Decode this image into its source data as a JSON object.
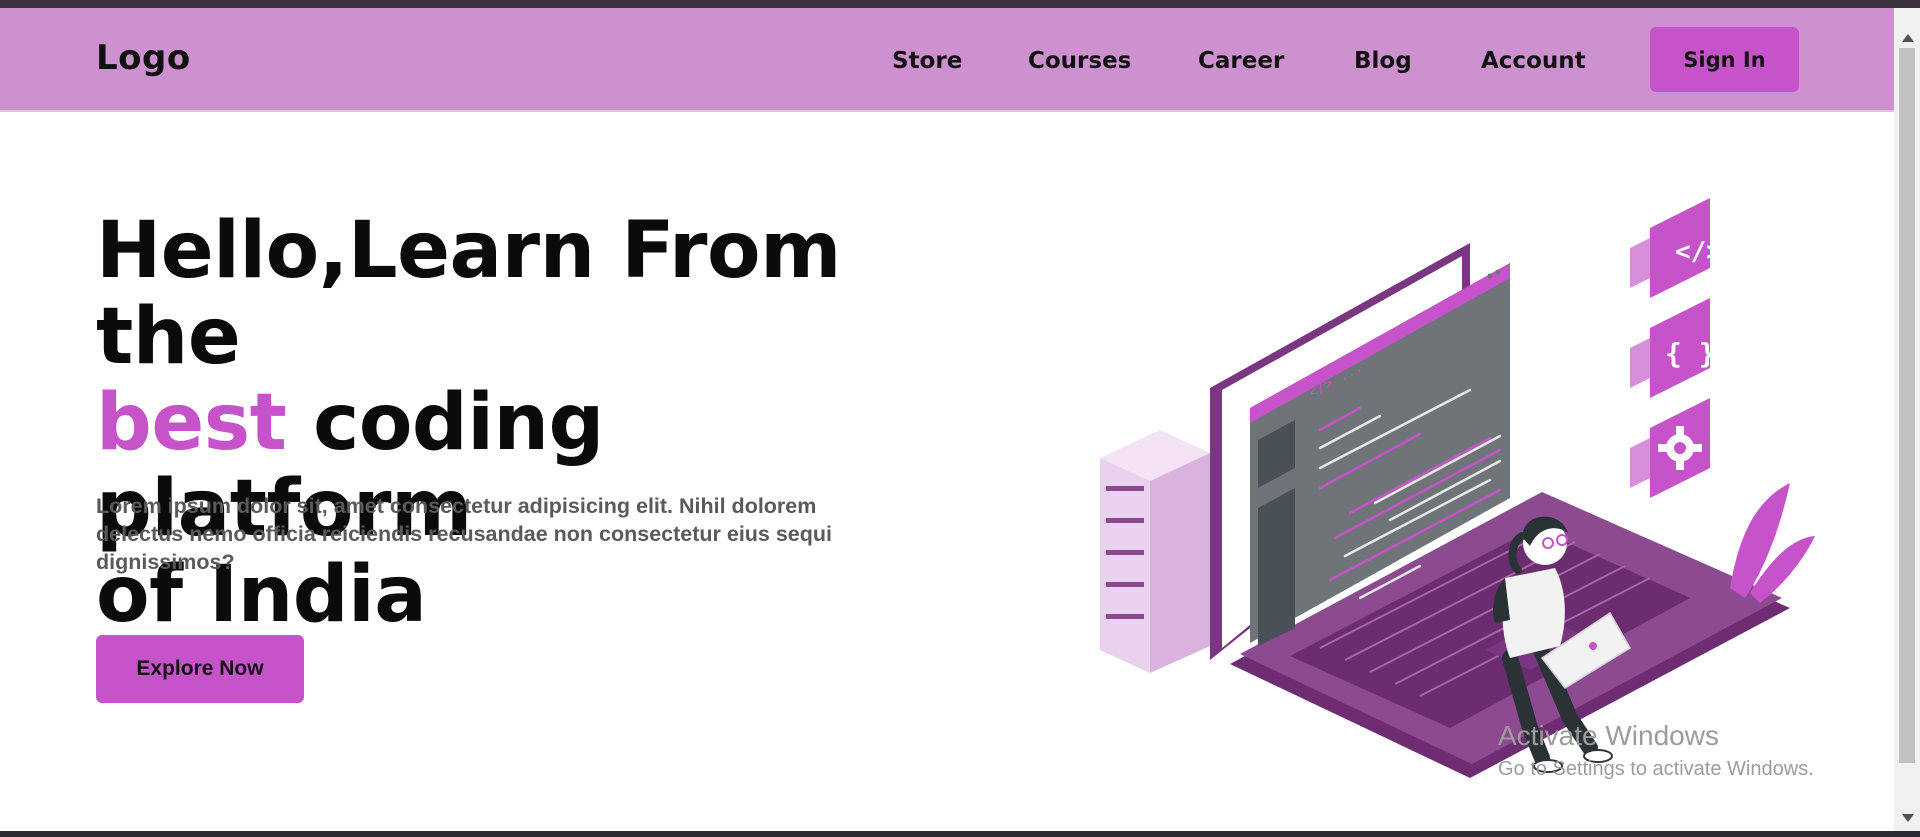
{
  "nav": {
    "logo": "Logo",
    "links": [
      "Store",
      "Courses",
      "Career",
      "Blog",
      "Account"
    ],
    "signin_label": "Sign In"
  },
  "hero": {
    "line1": "Hello,Learn From the",
    "accent": "best",
    "line2_rest": " coding platform",
    "line3": "of India",
    "paragraph": "Lorem ipsum dolor sit, amet consectetur adipisicing elit. Nihil dolorem delectus nemo officia reiciendis recusandae non consectetur eius sequi dignissimos?",
    "cta_label": "Explore Now"
  },
  "illustration": {
    "code_tag": "</>",
    "braces": "{ }",
    "screen_header": "</> ..."
  },
  "watermark": {
    "title": "Activate Windows",
    "subtitle": "Go to Settings to activate Windows."
  },
  "colors": {
    "nav_bg": "#cd91d0",
    "accent": "#c653c9",
    "dark_purple": "#6e2d73"
  }
}
